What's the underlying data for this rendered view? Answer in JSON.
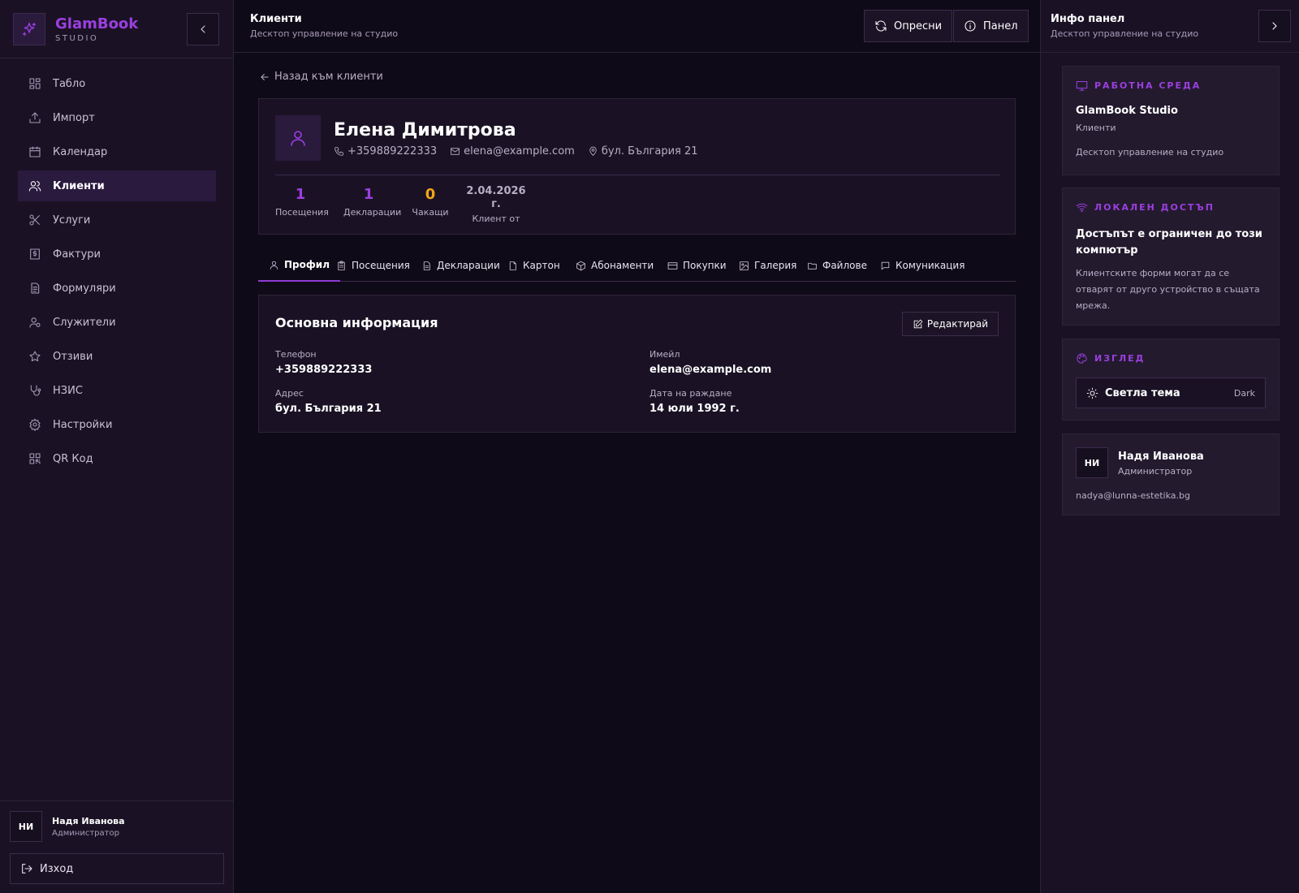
{
  "brand": {
    "name": "GlamBook",
    "sub": "STUDIO"
  },
  "sidebar": {
    "items": [
      {
        "label": "Табло",
        "icon": "dashboard-icon"
      },
      {
        "label": "Импорт",
        "icon": "upload-icon"
      },
      {
        "label": "Календар",
        "icon": "calendar-icon"
      },
      {
        "label": "Клиенти",
        "icon": "users-icon",
        "active": true
      },
      {
        "label": "Услуги",
        "icon": "scissors-icon"
      },
      {
        "label": "Фактури",
        "icon": "invoice-icon"
      },
      {
        "label": "Формуляри",
        "icon": "document-icon"
      },
      {
        "label": "Служители",
        "icon": "staff-icon"
      },
      {
        "label": "Отзиви",
        "icon": "star-icon"
      },
      {
        "label": "НЗИС",
        "icon": "stethoscope-icon"
      },
      {
        "label": "Настройки",
        "icon": "gear-icon"
      },
      {
        "label": "QR Код",
        "icon": "qr-code-icon"
      }
    ],
    "user": {
      "initials": "НИ",
      "name": "Надя Иванова",
      "role": "Администратор"
    },
    "logout_label": "Изход"
  },
  "topbar": {
    "title": "Клиенти",
    "subtitle": "Десктоп управление на студио",
    "refresh_label": "Опресни",
    "panel_label": "Панел"
  },
  "main": {
    "back_label": "Назад към клиенти",
    "client": {
      "name": "Елена Димитрова",
      "phone": "+359889222333",
      "email": "elena@example.com",
      "address": "бул. България 21"
    },
    "stats": [
      {
        "value": "1",
        "label": "Посещения",
        "color": "#9b3fe0"
      },
      {
        "value": "1",
        "label": "Декларации",
        "color": "#9b3fe0"
      },
      {
        "value": "0",
        "label": "Чакащи",
        "color": "#f2a516"
      }
    ],
    "client_since": {
      "value": "2.04.2026 г.",
      "label": "Клиент от"
    },
    "tabs": [
      {
        "label": "Профил",
        "icon": "user-icon",
        "active": true
      },
      {
        "label": "Посещения",
        "icon": "clipboard-icon"
      },
      {
        "label": "Декларации",
        "icon": "file-text-icon"
      },
      {
        "label": "Картон",
        "icon": "file-icon"
      },
      {
        "label": "Абонаменти",
        "icon": "package-icon"
      },
      {
        "label": "Покупки",
        "icon": "credit-card-icon"
      },
      {
        "label": "Галерия",
        "icon": "image-icon"
      },
      {
        "label": "Файлове",
        "icon": "folder-icon"
      },
      {
        "label": "Комуникация",
        "icon": "message-icon"
      }
    ],
    "info": {
      "title": "Основна информация",
      "edit_label": "Редактирай",
      "fields": [
        {
          "label": "Телефон",
          "value": "+359889222333"
        },
        {
          "label": "Имейл",
          "value": "elena@example.com"
        },
        {
          "label": "Адрес",
          "value": "бул. България 21"
        },
        {
          "label": "Дата на раждане",
          "value": "14 юли 1992 г."
        }
      ]
    }
  },
  "rightpanel": {
    "title": "Инфо панел",
    "subtitle": "Десктоп управление на студио",
    "workspace": {
      "heading": "РАБОТНА СРЕДА",
      "studio": "GlamBook Studio",
      "section": "Клиенти",
      "desc": "Десктоп управление на студио"
    },
    "local_access": {
      "heading": "ЛОКАЛЕН ДОСТЪП",
      "title": "Достъпът е ограничен до този компютър",
      "desc": "Клиентските форми могат да се отварят от друго устройство в същата мрежа."
    },
    "appearance": {
      "heading": "ИЗГЛЕД",
      "theme_label": "Светла тема",
      "mode": "Dark"
    },
    "user": {
      "initials": "НИ",
      "name": "Надя Иванова",
      "role": "Администратор",
      "email": "nadya@lunna-estetika.bg"
    }
  },
  "colors": {
    "accent": "#9b3fe0",
    "warning": "#f2a516",
    "background": "#0f0a17",
    "panel": "#1a1224"
  }
}
